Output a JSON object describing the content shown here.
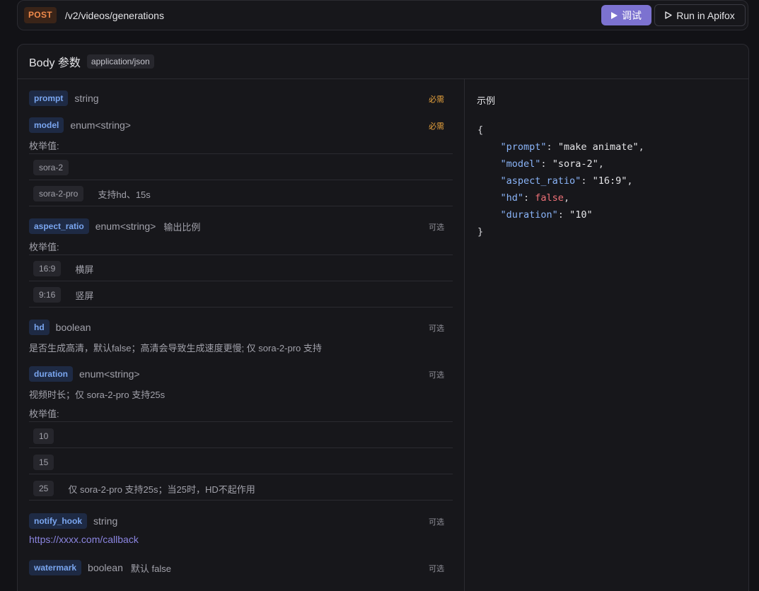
{
  "request": {
    "method": "POST",
    "path": "/v2/videos/generations",
    "debug_label": "调试",
    "run_label": "Run in Apifox"
  },
  "body": {
    "title": "Body 参数",
    "content_type": "application/json"
  },
  "labels": {
    "required": "必需",
    "optional": "可选",
    "enum_values": "枚举值:"
  },
  "params": {
    "prompt": {
      "name": "prompt",
      "type": "string"
    },
    "model": {
      "name": "model",
      "type": "enum<string>",
      "enums": [
        {
          "value": "sora-2",
          "desc": ""
        },
        {
          "value": "sora-2-pro",
          "desc": "支持hd、15s"
        }
      ]
    },
    "aspect_ratio": {
      "name": "aspect_ratio",
      "type": "enum<string>",
      "desc": "输出比例",
      "enums": [
        {
          "value": "16:9",
          "desc": "横屏"
        },
        {
          "value": "9:16",
          "desc": "竖屏"
        }
      ]
    },
    "hd": {
      "name": "hd",
      "type": "boolean",
      "desc": "是否生成高清，默认false；高清会导致生成速度更慢; 仅 sora-2-pro 支持"
    },
    "duration": {
      "name": "duration",
      "type": "enum<string>",
      "desc": "视频时长；仅 sora-2-pro 支持25s",
      "enums": [
        {
          "value": "10",
          "desc": ""
        },
        {
          "value": "15",
          "desc": ""
        },
        {
          "value": "25",
          "desc": "仅 sora-2-pro 支持25s；当25时，HD不起作用"
        }
      ]
    },
    "notify_hook": {
      "name": "notify_hook",
      "type": "string",
      "example": "https://xxxx.com/callback"
    },
    "watermark": {
      "name": "watermark",
      "type": "boolean",
      "desc": "默认 false"
    }
  },
  "example": {
    "label": "示例",
    "open": "{",
    "close": "}",
    "lines": [
      {
        "key": "\"prompt\"",
        "value": "\"make animate\"",
        "sep": ",",
        "kind": "string"
      },
      {
        "key": "\"model\"",
        "value": "\"sora-2\"",
        "sep": ",",
        "kind": "string"
      },
      {
        "key": "\"aspect_ratio\"",
        "value": "\"16:9\"",
        "sep": ",",
        "kind": "string"
      },
      {
        "key": "\"hd\"",
        "value": "false",
        "sep": ",",
        "kind": "bool"
      },
      {
        "key": "\"duration\"",
        "value": "\"10\"",
        "sep": "",
        "kind": "string"
      }
    ]
  },
  "colors": {
    "accent": "#7c72d0",
    "method_post": "#f08a4b",
    "required": "#e8a33d",
    "param_name": "#7aa6f0",
    "link": "#8b85e0"
  }
}
